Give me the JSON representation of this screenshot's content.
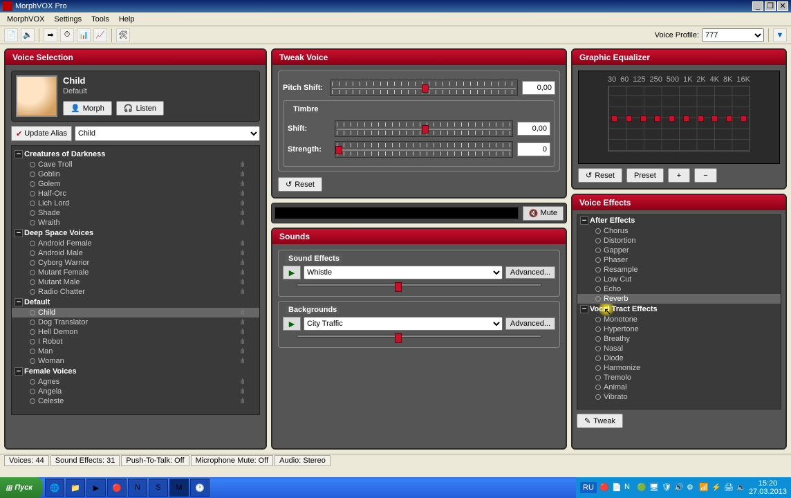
{
  "app": {
    "title": "MorphVOX Pro"
  },
  "menu": {
    "items": [
      "MorphVOX",
      "Settings",
      "Tools",
      "Help"
    ]
  },
  "toolbar": {
    "profile_label": "Voice Profile:",
    "profile_value": "777"
  },
  "panels": {
    "voice_selection": "Voice Selection",
    "tweak_voice": "Tweak Voice",
    "graphic_eq": "Graphic Equalizer",
    "voice_effects": "Voice Effects",
    "sounds": "Sounds"
  },
  "voice": {
    "name": "Child",
    "subtitle": "Default",
    "morph_btn": "Morph",
    "listen_btn": "Listen",
    "update_alias": "Update Alias",
    "alias_value": "Child"
  },
  "voice_tree": {
    "categories": [
      {
        "name": "Creatures of Darkness",
        "items": [
          "Cave Troll",
          "Goblin",
          "Golem",
          "Half-Orc",
          "Lich Lord",
          "Shade",
          "Wraith"
        ]
      },
      {
        "name": "Deep Space Voices",
        "items": [
          "Android Female",
          "Android Male",
          "Cyborg Warrior",
          "Mutant Female",
          "Mutant Male",
          "Radio Chatter"
        ]
      },
      {
        "name": "Default",
        "items": [
          "Child",
          "Dog Translator",
          "Hell Demon",
          "I Robot",
          "Man",
          "Woman"
        ],
        "selected": "Child"
      },
      {
        "name": "Female Voices",
        "items": [
          "Agnes",
          "Angela",
          "Celeste"
        ]
      }
    ]
  },
  "tweak": {
    "pitch_label": "Pitch Shift:",
    "pitch_value": "0,00",
    "timbre_label": "Timbre",
    "shift_label": "Shift:",
    "shift_value": "0,00",
    "strength_label": "Strength:",
    "strength_value": "0",
    "reset": "Reset"
  },
  "mute_btn": "Mute",
  "eq": {
    "bands": [
      "30",
      "60",
      "125",
      "250",
      "500",
      "1K",
      "2K",
      "4K",
      "8K",
      "16K"
    ],
    "reset": "Reset",
    "preset": "Preset",
    "plus": "+",
    "minus": "−"
  },
  "sounds": {
    "se_label": "Sound Effects",
    "se_value": "Whistle",
    "bg_label": "Backgrounds",
    "bg_value": "City Traffic",
    "advanced": "Advanced..."
  },
  "effects": {
    "categories": [
      {
        "name": "After Effects",
        "items": [
          "Chorus",
          "Distortion",
          "Gapper",
          "Phaser",
          "Resample",
          "Low Cut",
          "Echo",
          "Reverb"
        ]
      },
      {
        "name": "Vocal Tract Effects",
        "items": [
          "Monotone",
          "Hypertone",
          "Breathy",
          "Nasal",
          "Diode",
          "Harmonize",
          "Tremolo",
          "Animal",
          "Vibrato"
        ]
      }
    ],
    "highlighted": "Reverb",
    "tweak_btn": "Tweak"
  },
  "status": {
    "voices": "Voices: 44",
    "sfx": "Sound Effects: 31",
    "ptt": "Push-To-Talk: Off",
    "mic": "Microphone Mute: Off",
    "audio": "Audio: Stereo"
  },
  "taskbar": {
    "start": "Пуск",
    "lang": "RU",
    "time": "15:20",
    "date": "27.03.2013"
  }
}
